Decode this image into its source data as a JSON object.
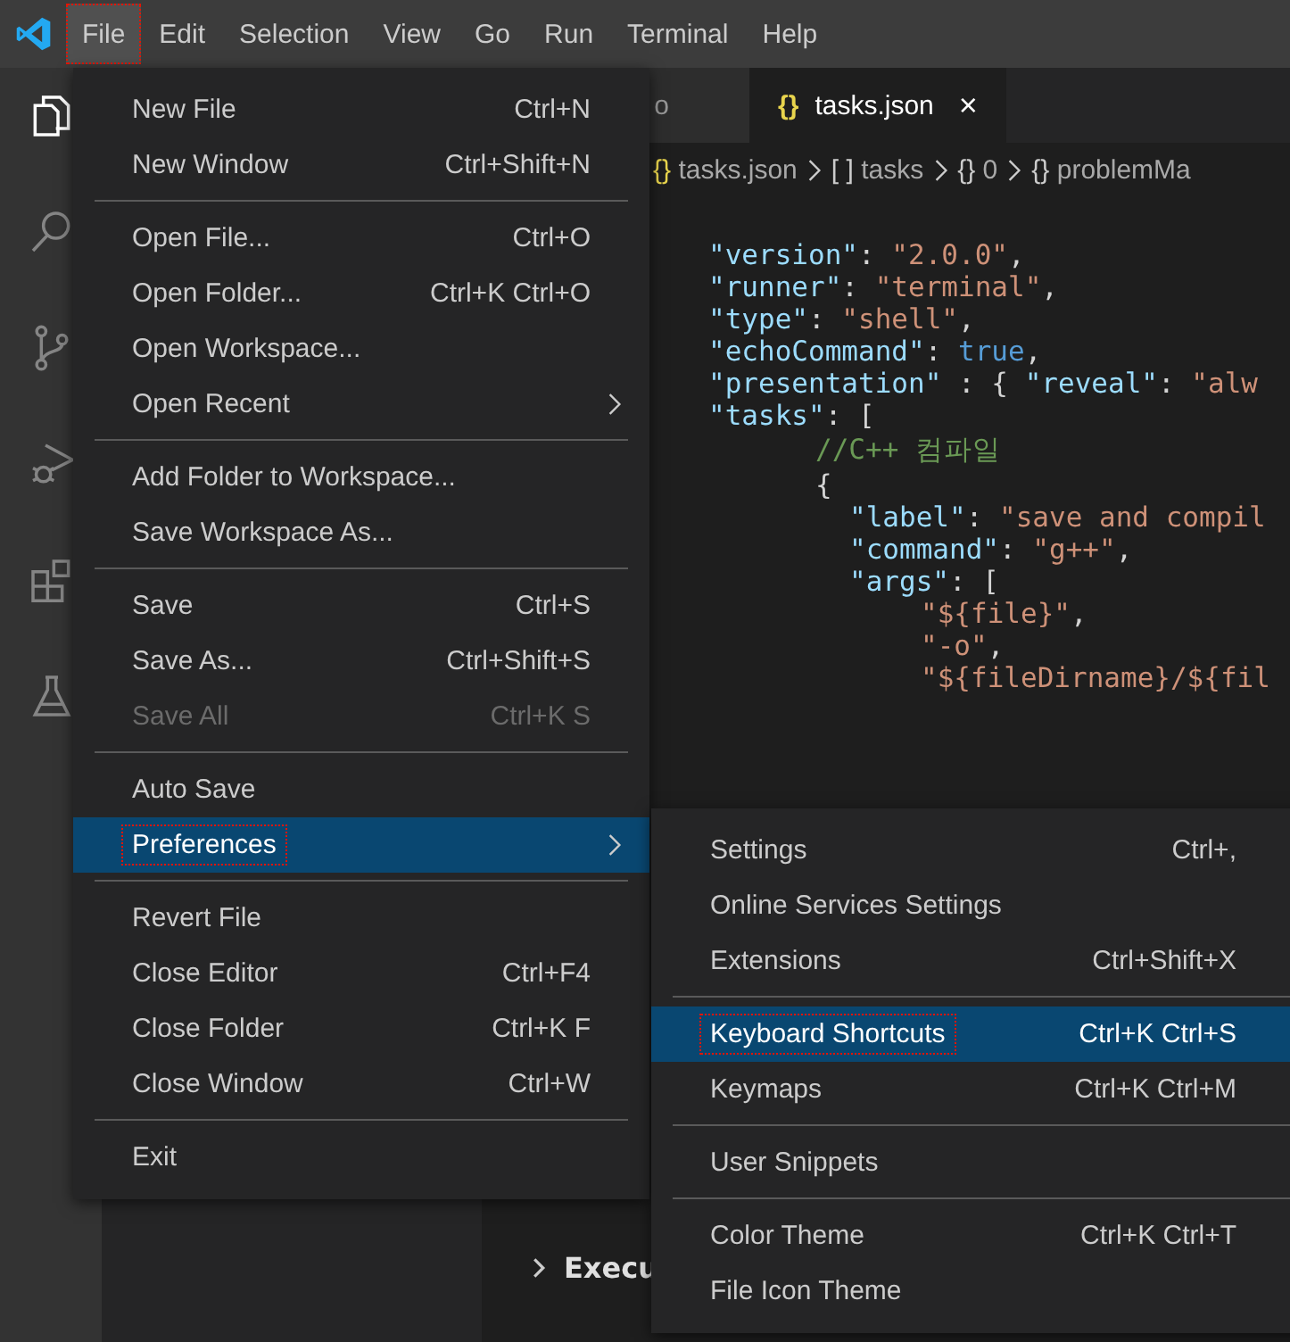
{
  "menubar": [
    {
      "label": "File",
      "selected": true,
      "outlined": true
    },
    {
      "label": "Edit",
      "selected": false,
      "outlined": false
    },
    {
      "label": "Selection",
      "selected": false,
      "outlined": false
    },
    {
      "label": "View",
      "selected": false,
      "outlined": false
    },
    {
      "label": "Go",
      "selected": false,
      "outlined": false
    },
    {
      "label": "Run",
      "selected": false,
      "outlined": false
    },
    {
      "label": "Terminal",
      "selected": false,
      "outlined": false
    },
    {
      "label": "Help",
      "selected": false,
      "outlined": false
    }
  ],
  "activity_bar": [
    {
      "kind": "files",
      "selected": true
    },
    {
      "kind": "search",
      "selected": false
    },
    {
      "kind": "source-control",
      "selected": false
    },
    {
      "kind": "debug",
      "selected": false
    },
    {
      "kind": "extensions",
      "selected": false
    },
    {
      "kind": "flask",
      "selected": false
    }
  ],
  "tabs": [
    {
      "label": "o",
      "selected": false
    },
    {
      "icon": "{}",
      "label": "tasks.json",
      "close": "×",
      "selected": true
    }
  ],
  "breadcrumb": [
    {
      "icon": "{}",
      "label": "tasks.json"
    },
    {
      "icon": "[ ]",
      "label": "tasks"
    },
    {
      "icon": "{}",
      "label": "0"
    },
    {
      "icon": "{}",
      "label": "problemMa"
    }
  ],
  "code": [
    {
      "tokens": [
        {
          "kind": "key",
          "text": "\"version\""
        },
        {
          "kind": "punct",
          "text": ": "
        },
        {
          "kind": "string",
          "text": "\"2.0.0\""
        },
        {
          "kind": "punct",
          "text": ","
        }
      ]
    },
    {
      "tokens": [
        {
          "kind": "key",
          "text": "\"runner\""
        },
        {
          "kind": "punct",
          "text": ": "
        },
        {
          "kind": "string",
          "text": "\"terminal\""
        },
        {
          "kind": "punct",
          "text": ","
        }
      ]
    },
    {
      "tokens": [
        {
          "kind": "key",
          "text": "\"type\""
        },
        {
          "kind": "punct",
          "text": ": "
        },
        {
          "kind": "string",
          "text": "\"shell\""
        },
        {
          "kind": "punct",
          "text": ","
        }
      ]
    },
    {
      "tokens": [
        {
          "kind": "key",
          "text": "\"echoCommand\""
        },
        {
          "kind": "punct",
          "text": ": "
        },
        {
          "kind": "keyword",
          "text": "true"
        },
        {
          "kind": "punct",
          "text": ","
        }
      ]
    },
    {
      "tokens": [
        {
          "kind": "key",
          "text": "\"presentation\""
        },
        {
          "kind": "punct",
          "text": " : { "
        },
        {
          "kind": "key",
          "text": "\"reveal\""
        },
        {
          "kind": "punct",
          "text": ": "
        },
        {
          "kind": "string",
          "text": "\"alw"
        }
      ]
    },
    {
      "tokens": [
        {
          "kind": "key",
          "text": "\"tasks\""
        },
        {
          "kind": "punct",
          "text": ": ["
        }
      ],
      "children": [
        {
          "tokens": [
            {
              "kind": "comment",
              "text": "//C++ 컴파일"
            }
          ]
        },
        {
          "tokens": [
            {
              "kind": "punct",
              "text": "{"
            }
          ],
          "children": [
            {
              "tokens": [
                {
                  "kind": "key",
                  "text": "\"label\""
                },
                {
                  "kind": "punct",
                  "text": ": "
                },
                {
                  "kind": "string",
                  "text": "\"save and compil"
                }
              ]
            },
            {
              "tokens": [
                {
                  "kind": "key",
                  "text": "\"command\""
                },
                {
                  "kind": "punct",
                  "text": ": "
                },
                {
                  "kind": "string",
                  "text": "\"g++\""
                },
                {
                  "kind": "punct",
                  "text": ","
                }
              ]
            },
            {
              "tokens": [
                {
                  "kind": "key",
                  "text": "\"args\""
                },
                {
                  "kind": "punct",
                  "text": ": ["
                }
              ],
              "children": [
                {
                  "tokens": [
                    {
                      "kind": "string",
                      "text": "\"${file}\""
                    },
                    {
                      "kind": "punct",
                      "text": ","
                    }
                  ]
                },
                {
                  "tokens": [
                    {
                      "kind": "string",
                      "text": "\"-o\""
                    },
                    {
                      "kind": "punct",
                      "text": ","
                    }
                  ]
                },
                {
                  "tokens": [
                    {
                      "kind": "string",
                      "text": "\"${fileDirname}/${fil"
                    }
                  ]
                }
              ]
            }
          ]
        }
      ]
    }
  ],
  "panel_heading": {
    "label": "Execu",
    "expanded": false
  },
  "file_menu": [
    {
      "kind": "item",
      "label": "New File",
      "shortcut": "Ctrl+N",
      "disabled": false,
      "submenu": false,
      "selected": false,
      "outlined": false
    },
    {
      "kind": "item",
      "label": "New Window",
      "shortcut": "Ctrl+Shift+N",
      "disabled": false,
      "submenu": false,
      "selected": false,
      "outlined": false
    },
    {
      "kind": "separator"
    },
    {
      "kind": "item",
      "label": "Open File...",
      "shortcut": "Ctrl+O",
      "disabled": false,
      "submenu": false,
      "selected": false,
      "outlined": false
    },
    {
      "kind": "item",
      "label": "Open Folder...",
      "shortcut": "Ctrl+K Ctrl+O",
      "disabled": false,
      "submenu": false,
      "selected": false,
      "outlined": false
    },
    {
      "kind": "item",
      "label": "Open Workspace...",
      "disabled": false,
      "submenu": false,
      "selected": false,
      "outlined": false
    },
    {
      "kind": "item",
      "label": "Open Recent",
      "disabled": false,
      "submenu": true,
      "selected": false,
      "outlined": false
    },
    {
      "kind": "separator"
    },
    {
      "kind": "item",
      "label": "Add Folder to Workspace...",
      "disabled": false,
      "submenu": false,
      "selected": false,
      "outlined": false
    },
    {
      "kind": "item",
      "label": "Save Workspace As...",
      "disabled": false,
      "submenu": false,
      "selected": false,
      "outlined": false
    },
    {
      "kind": "separator"
    },
    {
      "kind": "item",
      "label": "Save",
      "shortcut": "Ctrl+S",
      "disabled": false,
      "submenu": false,
      "selected": false,
      "outlined": false
    },
    {
      "kind": "item",
      "label": "Save As...",
      "shortcut": "Ctrl+Shift+S",
      "disabled": false,
      "submenu": false,
      "selected": false,
      "outlined": false
    },
    {
      "kind": "item",
      "label": "Save All",
      "shortcut": "Ctrl+K S",
      "disabled": true,
      "submenu": false,
      "selected": false,
      "outlined": false
    },
    {
      "kind": "separator"
    },
    {
      "kind": "item",
      "label": "Auto Save",
      "disabled": false,
      "submenu": false,
      "selected": false,
      "outlined": false
    },
    {
      "kind": "item",
      "label": "Preferences",
      "disabled": false,
      "submenu": true,
      "selected": true,
      "outlined": true
    },
    {
      "kind": "separator"
    },
    {
      "kind": "item",
      "label": "Revert File",
      "disabled": false,
      "submenu": false,
      "selected": false,
      "outlined": false
    },
    {
      "kind": "item",
      "label": "Close Editor",
      "shortcut": "Ctrl+F4",
      "disabled": false,
      "submenu": false,
      "selected": false,
      "outlined": false
    },
    {
      "kind": "item",
      "label": "Close Folder",
      "shortcut": "Ctrl+K F",
      "disabled": false,
      "submenu": false,
      "selected": false,
      "outlined": false
    },
    {
      "kind": "item",
      "label": "Close Window",
      "shortcut": "Ctrl+W",
      "disabled": false,
      "submenu": false,
      "selected": false,
      "outlined": false
    },
    {
      "kind": "separator"
    },
    {
      "kind": "item",
      "label": "Exit",
      "disabled": false,
      "submenu": false,
      "selected": false,
      "outlined": false
    }
  ],
  "preferences_menu": [
    {
      "kind": "item",
      "label": "Settings",
      "shortcut": "Ctrl+,",
      "selected": false,
      "outlined": false
    },
    {
      "kind": "item",
      "label": "Online Services Settings",
      "selected": false,
      "outlined": false
    },
    {
      "kind": "item",
      "label": "Extensions",
      "shortcut": "Ctrl+Shift+X",
      "selected": false,
      "outlined": false
    },
    {
      "kind": "separator"
    },
    {
      "kind": "item",
      "label": "Keyboard Shortcuts",
      "shortcut": "Ctrl+K Ctrl+S",
      "selected": true,
      "outlined": true
    },
    {
      "kind": "item",
      "label": "Keymaps",
      "shortcut": "Ctrl+K Ctrl+M",
      "selected": false,
      "outlined": false
    },
    {
      "kind": "separator"
    },
    {
      "kind": "item",
      "label": "User Snippets",
      "selected": false,
      "outlined": false
    },
    {
      "kind": "separator"
    },
    {
      "kind": "item",
      "label": "Color Theme",
      "shortcut": "Ctrl+K Ctrl+T",
      "selected": false,
      "outlined": false
    },
    {
      "kind": "item",
      "label": "File Icon Theme",
      "selected": false,
      "outlined": false
    }
  ]
}
